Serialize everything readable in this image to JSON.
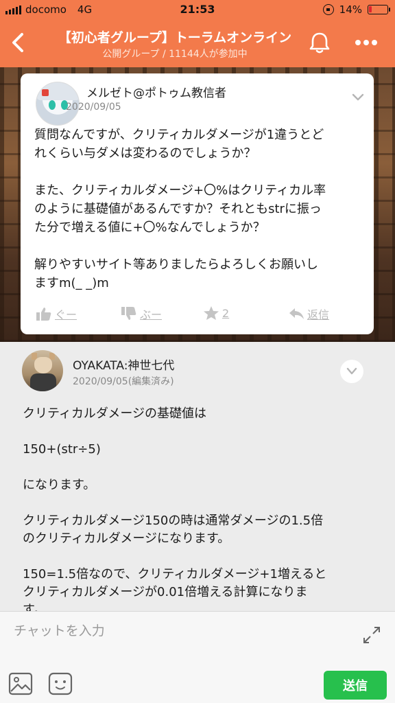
{
  "status_bar": {
    "carrier": "docomo",
    "network": "4G",
    "time": "21:53",
    "battery_percent": "14%",
    "battery_level": 0.14,
    "battery_color": "#e0242e"
  },
  "header": {
    "title": "【初心者グループ】トーラムオンライン",
    "subtitle": "公開グループ / 11144人が参加中",
    "back_icon": "chevron-left-icon",
    "bell_icon": "bell-icon",
    "more_icon": "more-horizontal-icon",
    "bg_color": "#f37a4b"
  },
  "post1": {
    "author": "メルゼト@ポトゥム教信者",
    "date": "2020/09/05",
    "paragraphs": [
      "質問なんですが、クリティカルダメージが1違うとど",
      "れくらい与ダメは変わるのでしょうか？",
      "",
      "また、クリティカルダメージ+〇%はクリティカル率",
      "のように基礎値があるんですか？それともstrに振っ",
      "た分で増える値に+〇%なんでしょうか？",
      "",
      "解りやすいサイト等ありましたらよろしくお願いし",
      "ますm(_ _)m"
    ],
    "actions": {
      "good": "ぐー",
      "boo": "ぶー",
      "star_count": "2",
      "reply": "返信"
    }
  },
  "post2": {
    "author": "OYAKATA:神世七代",
    "date": "2020/09/05(編集済み)",
    "paragraphs": [
      "クリティカルダメージの基礎値は",
      "",
      "150+(str÷5)",
      "",
      "になります。",
      "",
      "クリティカルダメージ150の時は通常ダメージの1.5倍",
      "のクリティカルダメージになります。",
      "",
      "150=1.5倍なので、クリティカルダメージ+1増えると",
      "クリティカルダメージが0.01倍増える計算になりま",
      "す。"
    ]
  },
  "chat": {
    "placeholder": "チャットを入力",
    "send_label": "送信",
    "send_color": "#27c04d"
  }
}
